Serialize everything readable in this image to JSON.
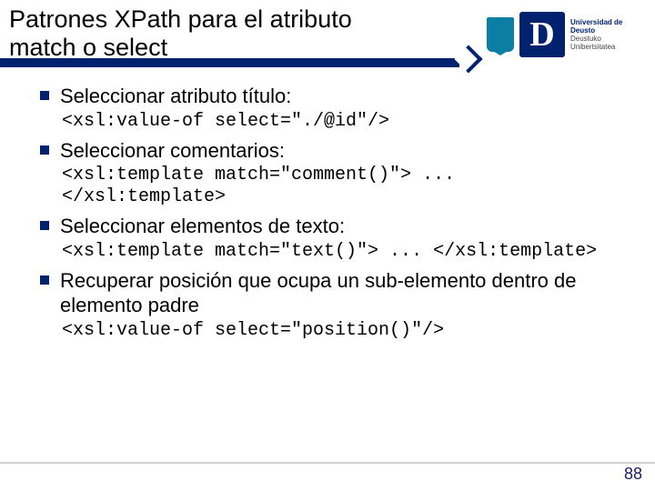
{
  "header": {
    "title_line1": "Patrones XPath para el atributo",
    "title_line2": "match o select",
    "logo_letter": "D",
    "uni_line1": "Universidad de Deusto",
    "uni_line2": "Deustuko Unibertsitatea"
  },
  "bullets": [
    {
      "text": "Seleccionar atributo título:",
      "code": "<xsl:value-of select=\"./@id\"/>"
    },
    {
      "text": "Seleccionar comentarios:",
      "code": "<xsl:template match=\"comment()\"> ... </xsl:template>"
    },
    {
      "text": "Seleccionar elementos de texto:",
      "code": "<xsl:template match=\"text()\"> ... </xsl:template>"
    },
    {
      "text": "Recuperar posición que ocupa un sub-elemento dentro de elemento padre",
      "code": "<xsl:value-of select=\"position()\"/>"
    }
  ],
  "page_number": "88"
}
